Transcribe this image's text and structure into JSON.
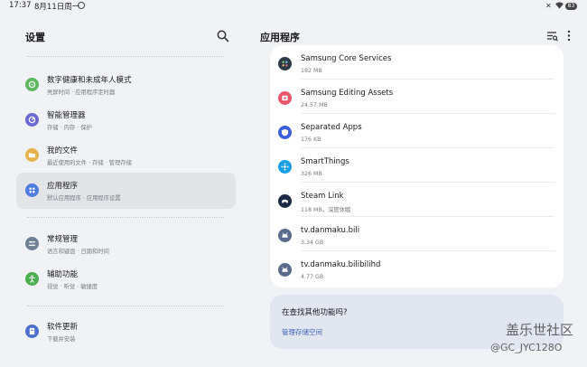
{
  "status": {
    "time": "17:37",
    "date": "8月11日周一",
    "battery": "83"
  },
  "left": {
    "title": "设置",
    "items": [
      {
        "title": "数字健康和未成年人模式",
        "subtitle": "亮屏时间 · 应用程序定时器",
        "icon": "digital-wellbeing-icon",
        "color": "#5cb85c"
      },
      {
        "title": "智能管理器",
        "subtitle": "存储 · 内存 · 保护",
        "icon": "device-care-icon",
        "color": "#6b69d6"
      },
      {
        "title": "我的文件",
        "subtitle": "最近使用的文件 · 存储 · 管理存储",
        "icon": "folder-icon",
        "color": "#e8b24a"
      },
      {
        "title": "应用程序",
        "subtitle": "默认应用程序 · 应用程序设置",
        "icon": "apps-icon",
        "color": "#4d7ee0"
      },
      {
        "title": "常规管理",
        "subtitle": "语言和键盘 · 日期和时间",
        "icon": "general-management-icon",
        "color": "#6e7f96"
      },
      {
        "title": "辅助功能",
        "subtitle": "视觉 · 听觉 · 敏捷度",
        "icon": "accessibility-icon",
        "color": "#4caf50"
      },
      {
        "title": "软件更新",
        "subtitle": "下载并安装",
        "icon": "software-update-icon",
        "color": "#4d6fd0"
      }
    ]
  },
  "right": {
    "title": "应用程序",
    "apps": [
      {
        "name": "Samsung Core Services",
        "size": "182 MB",
        "icon": "samsung-core-services-icon",
        "color": "#2d3b48"
      },
      {
        "name": "Samsung Editing Assets",
        "size": "24.57 MB",
        "icon": "editing-assets-icon",
        "color": "#e8566a"
      },
      {
        "name": "Separated Apps",
        "size": "176 KB",
        "icon": "separated-apps-icon",
        "color": "#3b5fd8"
      },
      {
        "name": "SmartThings",
        "size": "326 MB",
        "icon": "smartthings-icon",
        "color": "#18a0e6"
      },
      {
        "name": "Steam Link",
        "size": "118 MB，深度休眠",
        "icon": "steam-link-icon",
        "color": "#1b2a44"
      },
      {
        "name": "tv.danmaku.bili",
        "size": "3.34 GB",
        "icon": "android-app-icon",
        "color": "#5a6b8c"
      },
      {
        "name": "tv.danmaku.bilibilihd",
        "size": "4.77 GB",
        "icon": "android-app-icon",
        "color": "#5a6b8c"
      }
    ]
  },
  "suggest": {
    "question": "在查找其他功能吗?",
    "link": "管理存储空间"
  },
  "watermark": {
    "line1": "盖乐世社区",
    "line2": "@GC_JYC128O"
  }
}
